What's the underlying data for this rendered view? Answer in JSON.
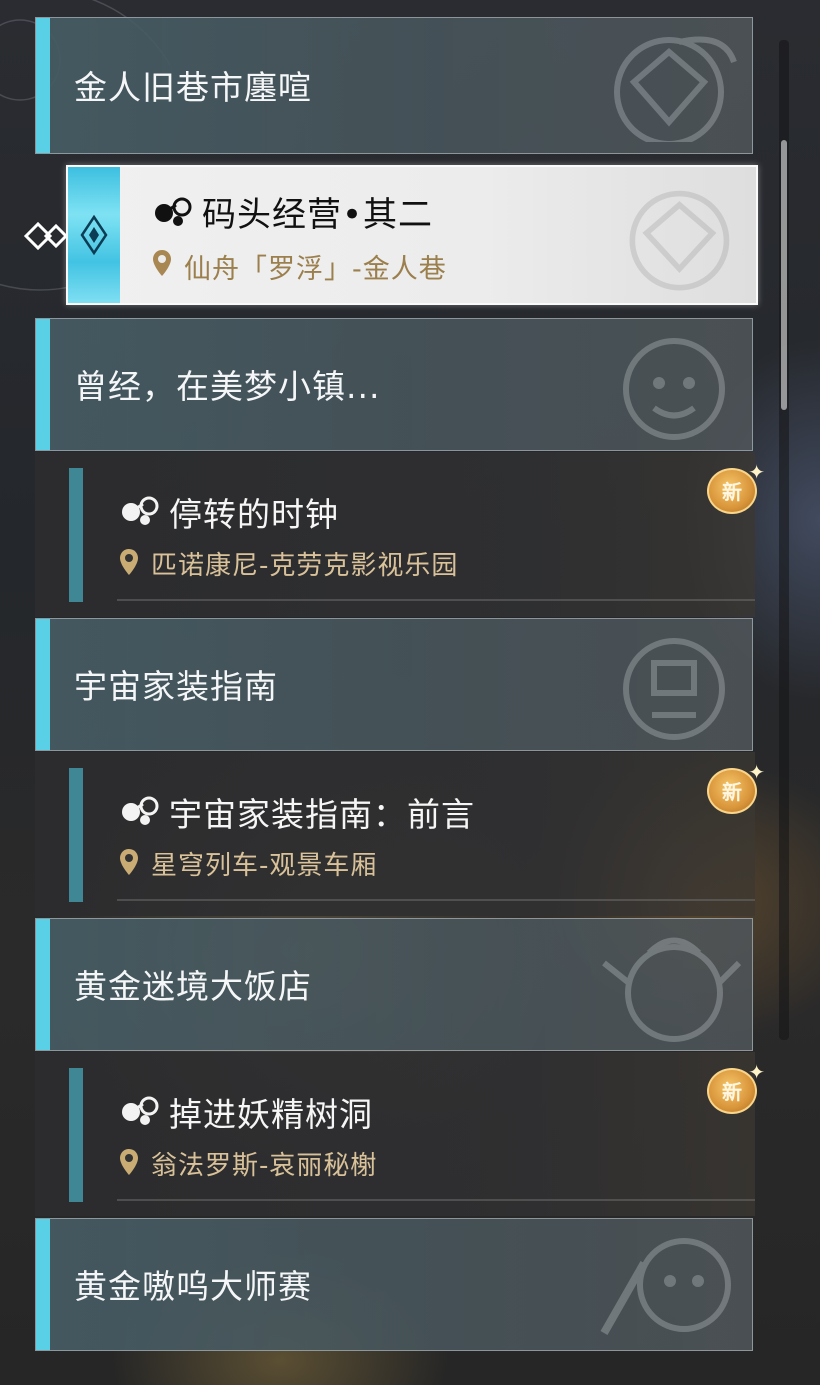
{
  "quest_log": {
    "categories": [
      {
        "title": "金人旧巷市廛喧"
      },
      {
        "title": "曾经，在美梦小镇..."
      },
      {
        "title": "宇宙家装指南"
      },
      {
        "title": "黄金迷境大饭店"
      },
      {
        "title": "黄金嗷呜大师赛"
      }
    ],
    "selected_quest": {
      "title": "码头经营•其二",
      "location": "仙舟「罗浮」-金人巷"
    },
    "quests": [
      {
        "title": "停转的时钟",
        "location": "匹诺康尼-克劳克影视乐园",
        "badge": "新"
      },
      {
        "title": "宇宙家装指南：前言",
        "location": "星穹列车-观景车厢",
        "badge": "新"
      },
      {
        "title": "掉进妖精树洞",
        "location": "翁法罗斯-哀丽秘榭",
        "badge": "新"
      }
    ]
  },
  "colors": {
    "category_accent": "#5ad0e6",
    "quest_bar": "#3f8795",
    "location_text": "#d9c29a",
    "badge_gold": "#d9953a"
  },
  "icons": {
    "quest_type": "companion-mission-icon",
    "location": "location-pin-icon",
    "selection": "diamond-pointer-icon"
  }
}
